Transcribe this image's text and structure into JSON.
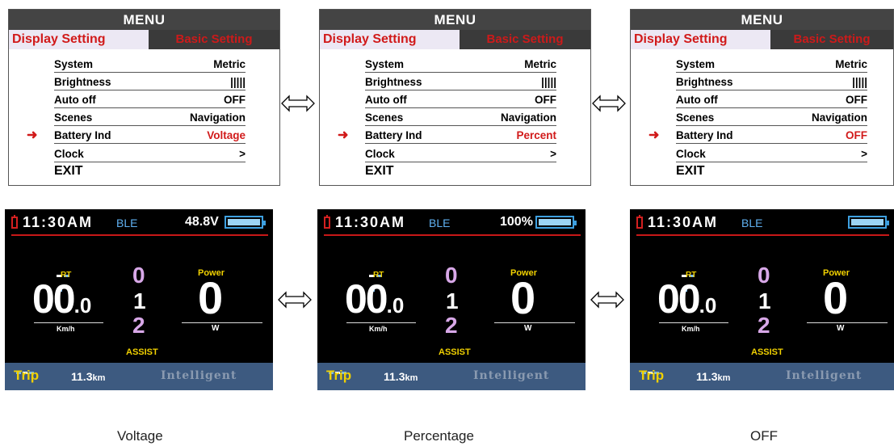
{
  "menus": [
    {
      "title": "MENU",
      "tab_active": "Display Setting",
      "tab_inactive": "Basic Setting",
      "rows": [
        {
          "label": "System",
          "value": "Metric"
        },
        {
          "label": "Brightness",
          "value": "|||||"
        },
        {
          "label": "Auto off",
          "value": "OFF"
        },
        {
          "label": "Scenes",
          "value": "Navigation"
        },
        {
          "label": "Battery Ind",
          "value": "Voltage"
        },
        {
          "label": "Clock",
          "value": ">"
        },
        {
          "label": "EXIT",
          "value": ""
        }
      ],
      "selector": "➜"
    },
    {
      "title": "MENU",
      "tab_active": "Display Setting",
      "tab_inactive": "Basic Setting",
      "rows": [
        {
          "label": "System",
          "value": "Metric"
        },
        {
          "label": "Brightness",
          "value": "|||||"
        },
        {
          "label": "Auto off",
          "value": "OFF"
        },
        {
          "label": "Scenes",
          "value": "Navigation"
        },
        {
          "label": "Battery Ind",
          "value": "Percent"
        },
        {
          "label": "Clock",
          "value": ">"
        },
        {
          "label": "EXIT",
          "value": ""
        }
      ],
      "selector": "➜"
    },
    {
      "title": "MENU",
      "tab_active": "Display Setting",
      "tab_inactive": "Basic Setting",
      "rows": [
        {
          "label": "System",
          "value": "Metric"
        },
        {
          "label": "Brightness",
          "value": "|||||"
        },
        {
          "label": "Auto off",
          "value": "OFF"
        },
        {
          "label": "Scenes",
          "value": "Navigation"
        },
        {
          "label": "Battery Ind",
          "value": "OFF"
        },
        {
          "label": "Clock",
          "value": ">"
        },
        {
          "label": "EXIT",
          "value": ""
        }
      ],
      "selector": "➜"
    }
  ],
  "screens": [
    {
      "time": "11:30AM",
      "ble": "BLE",
      "battery_text": "48.8V",
      "rt": "RT",
      "speed": "00",
      "speed_decimal": ".0",
      "speed_unit": "Km/h",
      "gear_0": "0",
      "gear_1": "1",
      "gear_2": "2",
      "power_label": "Power",
      "power_value": "0",
      "power_unit": "W",
      "assist": "ASSIST",
      "trip": "Trip",
      "distance": "11.3",
      "distance_unit": "km",
      "mode": "Intelligent"
    },
    {
      "time": "11:30AM",
      "ble": "BLE",
      "battery_text": "100%",
      "rt": "RT",
      "speed": "00",
      "speed_decimal": ".0",
      "speed_unit": "Km/h",
      "gear_0": "0",
      "gear_1": "1",
      "gear_2": "2",
      "power_label": "Power",
      "power_value": "0",
      "power_unit": "W",
      "assist": "ASSIST",
      "trip": "Trip",
      "distance": "11.3",
      "distance_unit": "km",
      "mode": "Intelligent"
    },
    {
      "time": "11:30AM",
      "ble": "BLE",
      "battery_text": "",
      "rt": "RT",
      "speed": "00",
      "speed_decimal": ".0",
      "speed_unit": "Km/h",
      "gear_0": "0",
      "gear_1": "1",
      "gear_2": "2",
      "power_label": "Power",
      "power_value": "0",
      "power_unit": "W",
      "assist": "ASSIST",
      "trip": "Trip",
      "distance": "11.3",
      "distance_unit": "km",
      "mode": "Intelligent"
    }
  ],
  "captions": [
    "Voltage",
    "Percentage",
    "OFF"
  ],
  "colors": {
    "accent_red": "#d11a1a",
    "assist_yellow": "#f0d000",
    "status_bar_blue": "#3d5a80",
    "battery_blue": "#3ea0e0"
  }
}
